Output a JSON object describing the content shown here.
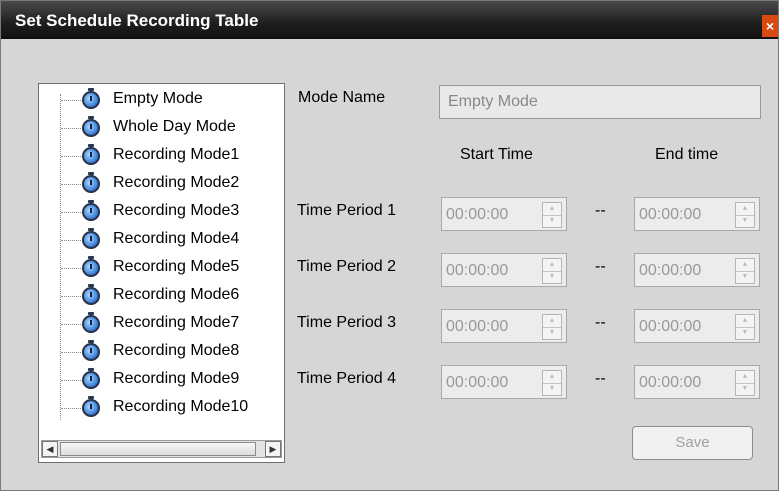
{
  "dialog": {
    "title": "Set Schedule Recording Table",
    "close_glyph": "×"
  },
  "tree": {
    "items": [
      {
        "label": "Empty Mode",
        "icon": "clock-icon"
      },
      {
        "label": "Whole Day Mode",
        "icon": "clock-icon"
      },
      {
        "label": "Recording Mode1",
        "icon": "clock-icon"
      },
      {
        "label": "Recording Mode2",
        "icon": "clock-icon"
      },
      {
        "label": "Recording Mode3",
        "icon": "clock-icon"
      },
      {
        "label": "Recording Mode4",
        "icon": "clock-icon"
      },
      {
        "label": "Recording Mode5",
        "icon": "clock-icon"
      },
      {
        "label": "Recording Mode6",
        "icon": "clock-icon"
      },
      {
        "label": "Recording Mode7",
        "icon": "clock-icon"
      },
      {
        "label": "Recording Mode8",
        "icon": "clock-icon"
      },
      {
        "label": "Recording Mode9",
        "icon": "clock-icon"
      },
      {
        "label": "Recording Mode10",
        "icon": "clock-icon"
      }
    ],
    "scroll_left_glyph": "◀",
    "scroll_right_glyph": "▶"
  },
  "form": {
    "mode_name_label": "Mode Name",
    "mode_name_value": "Empty Mode",
    "start_header": "Start Time",
    "end_header": "End time",
    "separator": "--",
    "periods": [
      {
        "label": "Time Period 1",
        "start": "00:00:00",
        "end": "00:00:00"
      },
      {
        "label": "Time Period 2",
        "start": "00:00:00",
        "end": "00:00:00"
      },
      {
        "label": "Time Period 3",
        "start": "00:00:00",
        "end": "00:00:00"
      },
      {
        "label": "Time Period 4",
        "start": "00:00:00",
        "end": "00:00:00"
      }
    ],
    "save_label": "Save"
  },
  "colors": {
    "titlebar": "#1e1e1e",
    "dialog_bg": "#d6d6d6",
    "close_accent": "#d94a12"
  }
}
